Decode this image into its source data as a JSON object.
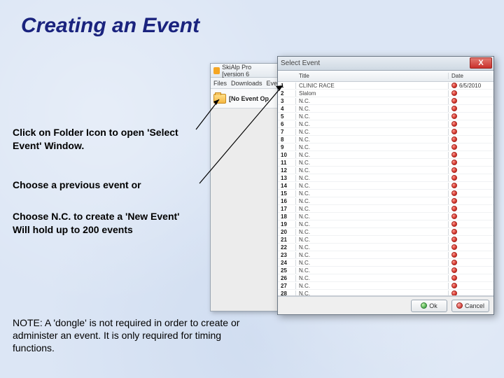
{
  "title": "Creating an Event",
  "instructions": {
    "step1": "Click on Folder Icon to open 'Select Event' Window.",
    "step2": "Choose a previous event or",
    "step3": "Choose N.C. to create a 'New Event'\nWill hold up to 200 events"
  },
  "note": "NOTE: A 'dongle' is not required in order to create or administer an event. It is only required for timing functions.",
  "app": {
    "title": "SkiAlp Pro [version 6",
    "menus": [
      "Files",
      "Downloads",
      "Eve"
    ],
    "no_event_label": "[No Event Op"
  },
  "dialog": {
    "title": "Select Event",
    "close_label": "X",
    "columns": {
      "num": "",
      "title": "Title",
      "date": "Date"
    },
    "events": [
      {
        "n": "1",
        "title": "CLINIC RACE",
        "date": "6/5/2010"
      },
      {
        "n": "2",
        "title": "Slalom",
        "date": ""
      },
      {
        "n": "3",
        "title": "N.C.",
        "date": ""
      },
      {
        "n": "4",
        "title": "N.C.",
        "date": ""
      },
      {
        "n": "5",
        "title": "N.C.",
        "date": ""
      },
      {
        "n": "6",
        "title": "N.C.",
        "date": ""
      },
      {
        "n": "7",
        "title": "N.C.",
        "date": ""
      },
      {
        "n": "8",
        "title": "N.C.",
        "date": ""
      },
      {
        "n": "9",
        "title": "N.C.",
        "date": ""
      },
      {
        "n": "10",
        "title": "N.C.",
        "date": ""
      },
      {
        "n": "11",
        "title": "N.C.",
        "date": ""
      },
      {
        "n": "12",
        "title": "N.C.",
        "date": ""
      },
      {
        "n": "13",
        "title": "N.C.",
        "date": ""
      },
      {
        "n": "14",
        "title": "N.C.",
        "date": ""
      },
      {
        "n": "15",
        "title": "N.C.",
        "date": ""
      },
      {
        "n": "16",
        "title": "N.C.",
        "date": ""
      },
      {
        "n": "17",
        "title": "N.C.",
        "date": ""
      },
      {
        "n": "18",
        "title": "N.C.",
        "date": ""
      },
      {
        "n": "19",
        "title": "N.C.",
        "date": ""
      },
      {
        "n": "20",
        "title": "N.C.",
        "date": ""
      },
      {
        "n": "21",
        "title": "N.C.",
        "date": ""
      },
      {
        "n": "22",
        "title": "N.C.",
        "date": ""
      },
      {
        "n": "23",
        "title": "N.C.",
        "date": ""
      },
      {
        "n": "24",
        "title": "N.C.",
        "date": ""
      },
      {
        "n": "25",
        "title": "N.C.",
        "date": ""
      },
      {
        "n": "26",
        "title": "N.C.",
        "date": ""
      },
      {
        "n": "27",
        "title": "N.C.",
        "date": ""
      },
      {
        "n": "28",
        "title": "N.C.",
        "date": ""
      }
    ],
    "ok_label": "Ok",
    "cancel_label": "Cancel"
  }
}
